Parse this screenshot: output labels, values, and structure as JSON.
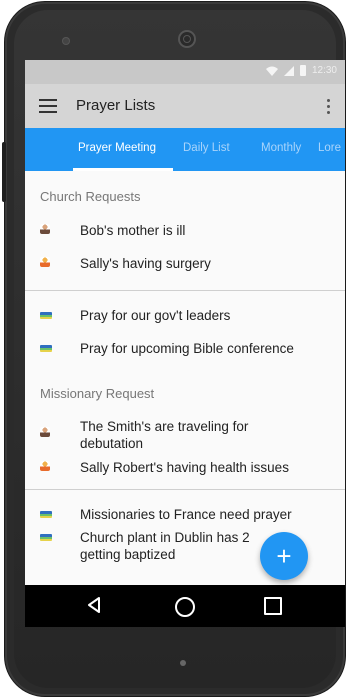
{
  "statusbar": {
    "time": "12:30"
  },
  "toolbar": {
    "title": "Prayer Lists"
  },
  "tabs": [
    {
      "label": "Prayer Meeting",
      "active": true
    },
    {
      "label": "Daily List",
      "active": false
    },
    {
      "label": "Monthly",
      "active": false
    },
    {
      "label": "Lore",
      "active": false
    }
  ],
  "sections": [
    {
      "title": "Church Requests"
    },
    {
      "title": "Missionary Request"
    }
  ],
  "items": [
    {
      "label": "Bob's mother is ill",
      "icon": "man-icon"
    },
    {
      "label": "Sally's having surgery",
      "icon": "woman-icon"
    },
    {
      "label": "Pray for our gov't leaders",
      "icon": "flag-icon"
    },
    {
      "label": "Pray for upcoming Bible conference",
      "icon": "flag-icon"
    },
    {
      "label": "The Smith's are traveling for debutation",
      "icon": "man-icon"
    },
    {
      "label": "Sally Robert's having health issues",
      "icon": "woman-icon"
    },
    {
      "label": "Missionaries to France need prayer",
      "icon": "flag-icon"
    },
    {
      "label": "Church plant in Dublin has 2 getting baptized",
      "icon": "flag-icon"
    }
  ],
  "fab": {
    "label": "+"
  },
  "colors": {
    "primary": "#2196f3",
    "toolbar": "#d5d5d5",
    "statusbar": "#c8c8c8"
  }
}
